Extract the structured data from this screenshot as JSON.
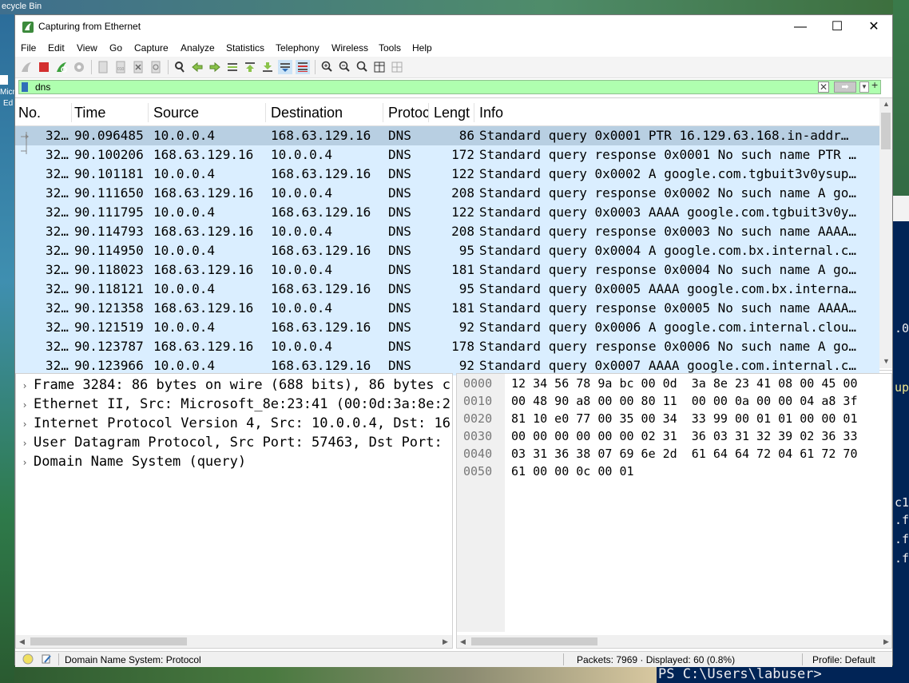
{
  "desktop": {
    "top_label": "ecycle Bin",
    "left_labels": [
      "Micr",
      "Ed"
    ],
    "ps_prompt": "PS C:\\Users\\labuser>",
    "ps_fragments": [
      ".0",
      "up",
      "c1",
      ".f:",
      ".f:",
      ".f:"
    ]
  },
  "window": {
    "title": "Capturing from Ethernet"
  },
  "menu": [
    "File",
    "Edit",
    "View",
    "Go",
    "Capture",
    "Analyze",
    "Statistics",
    "Telephony",
    "Wireless",
    "Tools",
    "Help"
  ],
  "filter": {
    "value": "dns"
  },
  "columns": [
    "No.",
    "Time",
    "Source",
    "Destination",
    "Protoc",
    "Lengt",
    "Info"
  ],
  "packets": [
    {
      "no": "32…",
      "time": "90.096485",
      "src": "10.0.0.4",
      "dst": "168.63.129.16",
      "proto": "DNS",
      "len": "86",
      "info": "Standard query 0x0001 PTR 16.129.63.168.in-addr…"
    },
    {
      "no": "32…",
      "time": "90.100206",
      "src": "168.63.129.16",
      "dst": "10.0.0.4",
      "proto": "DNS",
      "len": "172",
      "info": "Standard query response 0x0001 No such name PTR …"
    },
    {
      "no": "32…",
      "time": "90.101181",
      "src": "10.0.0.4",
      "dst": "168.63.129.16",
      "proto": "DNS",
      "len": "122",
      "info": "Standard query 0x0002 A google.com.tgbuit3v0ysup…"
    },
    {
      "no": "32…",
      "time": "90.111650",
      "src": "168.63.129.16",
      "dst": "10.0.0.4",
      "proto": "DNS",
      "len": "208",
      "info": "Standard query response 0x0002 No such name A go…"
    },
    {
      "no": "32…",
      "time": "90.111795",
      "src": "10.0.0.4",
      "dst": "168.63.129.16",
      "proto": "DNS",
      "len": "122",
      "info": "Standard query 0x0003 AAAA google.com.tgbuit3v0y…"
    },
    {
      "no": "32…",
      "time": "90.114793",
      "src": "168.63.129.16",
      "dst": "10.0.0.4",
      "proto": "DNS",
      "len": "208",
      "info": "Standard query response 0x0003 No such name AAAA…"
    },
    {
      "no": "32…",
      "time": "90.114950",
      "src": "10.0.0.4",
      "dst": "168.63.129.16",
      "proto": "DNS",
      "len": "95",
      "info": "Standard query 0x0004 A google.com.bx.internal.c…"
    },
    {
      "no": "32…",
      "time": "90.118023",
      "src": "168.63.129.16",
      "dst": "10.0.0.4",
      "proto": "DNS",
      "len": "181",
      "info": "Standard query response 0x0004 No such name A go…"
    },
    {
      "no": "32…",
      "time": "90.118121",
      "src": "10.0.0.4",
      "dst": "168.63.129.16",
      "proto": "DNS",
      "len": "95",
      "info": "Standard query 0x0005 AAAA google.com.bx.interna…"
    },
    {
      "no": "32…",
      "time": "90.121358",
      "src": "168.63.129.16",
      "dst": "10.0.0.4",
      "proto": "DNS",
      "len": "181",
      "info": "Standard query response 0x0005 No such name AAAA…"
    },
    {
      "no": "32…",
      "time": "90.121519",
      "src": "10.0.0.4",
      "dst": "168.63.129.16",
      "proto": "DNS",
      "len": "92",
      "info": "Standard query 0x0006 A google.com.internal.clou…"
    },
    {
      "no": "32…",
      "time": "90.123787",
      "src": "168.63.129.16",
      "dst": "10.0.0.4",
      "proto": "DNS",
      "len": "178",
      "info": "Standard query response 0x0006 No such name A go…"
    },
    {
      "no": "32…",
      "time": "90.123966",
      "src": "10.0.0.4",
      "dst": "168.63.129.16",
      "proto": "DNS",
      "len": "92",
      "info": "Standard query 0x0007 AAAA google.com.internal.c…"
    }
  ],
  "details": [
    "Frame 3284: 86 bytes on wire (688 bits), 86 bytes ca",
    "Ethernet II, Src: Microsoft_8e:23:41 (00:0d:3a:8e:23",
    "Internet Protocol Version 4, Src: 10.0.0.4, Dst: 168",
    "User Datagram Protocol, Src Port: 57463, Dst Port: 5",
    "Domain Name System (query)"
  ],
  "bytes": [
    {
      "off": "0000",
      "hex": "12 34 56 78 9a bc 00 0d  3a 8e 23 41 08 00 45 00"
    },
    {
      "off": "0010",
      "hex": "00 48 90 a8 00 00 80 11  00 00 0a 00 00 04 a8 3f"
    },
    {
      "off": "0020",
      "hex": "81 10 e0 77 00 35 00 34  33 99 00 01 01 00 00 01"
    },
    {
      "off": "0030",
      "hex": "00 00 00 00 00 00 02 31  36 03 31 32 39 02 36 33"
    },
    {
      "off": "0040",
      "hex": "03 31 36 38 07 69 6e 2d  61 64 64 72 04 61 72 70"
    },
    {
      "off": "0050",
      "hex": "61 00 00 0c 00 01"
    }
  ],
  "status": {
    "field": "Domain Name System: Protocol",
    "packets": "Packets: 7969 · Displayed: 60 (0.8%)",
    "profile": "Profile: Default"
  }
}
